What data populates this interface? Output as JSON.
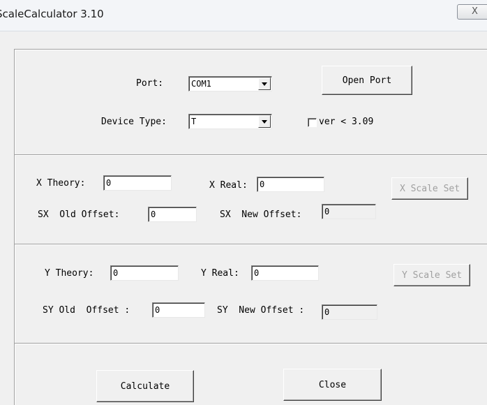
{
  "window": {
    "title": "ScaleCalculator 3.10",
    "close_glyph": "X"
  },
  "port_group": {
    "port_label": "Port:",
    "port_value": "COM1",
    "open_port_label": "Open Port",
    "device_type_label": "Device Type:",
    "device_type_value": "T",
    "ver_checkbox_label": "ver < 3.09",
    "ver_checked": false
  },
  "x_group": {
    "theory_label": "X Theory:",
    "theory_value": "0",
    "real_label": "X Real:",
    "real_value": "0",
    "scale_set_label": "X Scale Set",
    "old_offset_label": "SX  Old Offset:",
    "old_offset_value": "0",
    "new_offset_label": "SX  New Offset:",
    "new_offset_value": "0"
  },
  "y_group": {
    "theory_label": "Y Theory:",
    "theory_value": "0",
    "real_label": "Y Real:",
    "real_value": "0",
    "scale_set_label": "Y Scale Set",
    "old_offset_label": "SY Old  Offset :",
    "old_offset_value": "0",
    "new_offset_label": "SY  New Offset :",
    "new_offset_value": "0"
  },
  "actions": {
    "calculate_label": "Calculate",
    "close_label": "Close"
  }
}
